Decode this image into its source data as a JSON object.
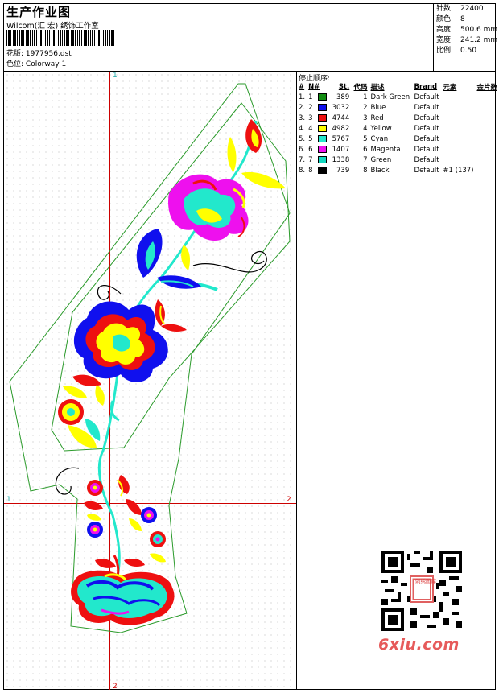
{
  "header": {
    "title": "生产作业图",
    "company": "Wilcom(汇 宏) 绣饰工作室",
    "design_label": "花版:",
    "design_value": "1977956.dst",
    "color_label": "色位:",
    "color_value": "Colorway 1"
  },
  "stats": [
    {
      "label": "针数:",
      "value": "22400"
    },
    {
      "label": "颜色:",
      "value": "8"
    },
    {
      "label": "高度:",
      "value": "500.6 mm"
    },
    {
      "label": "宽度:",
      "value": "241.2 mm"
    },
    {
      "label": "比例:",
      "value": "0.50"
    }
  ],
  "guides": {
    "top": "1",
    "left": "1",
    "right": "2",
    "bottom": "2"
  },
  "sequence": {
    "title": "停止顺序:",
    "headers": [
      "#",
      "N#",
      "St.",
      "代码",
      "描述",
      "Brand",
      "元素",
      "金片数"
    ],
    "rows": [
      {
        "idx": "1.",
        "n": "1",
        "color": "#118c11",
        "st": "389",
        "code": "1",
        "desc": "Dark Green",
        "brand": "Default",
        "elem": "",
        "seq": ""
      },
      {
        "idx": "2.",
        "n": "2",
        "color": "#1010ee",
        "st": "3032",
        "code": "2",
        "desc": "Blue",
        "brand": "Default",
        "elem": "",
        "seq": ""
      },
      {
        "idx": "3.",
        "n": "3",
        "color": "#ee1010",
        "st": "4744",
        "code": "3",
        "desc": "Red",
        "brand": "Default",
        "elem": "",
        "seq": ""
      },
      {
        "idx": "4.",
        "n": "4",
        "color": "#ffff00",
        "st": "4982",
        "code": "4",
        "desc": "Yellow",
        "brand": "Default",
        "elem": "",
        "seq": ""
      },
      {
        "idx": "5.",
        "n": "5",
        "color": "#22e8cc",
        "st": "5767",
        "code": "5",
        "desc": "Cyan",
        "brand": "Default",
        "elem": "",
        "seq": ""
      },
      {
        "idx": "6.",
        "n": "6",
        "color": "#ee10ee",
        "st": "1407",
        "code": "6",
        "desc": "Magenta",
        "brand": "Default",
        "elem": "",
        "seq": ""
      },
      {
        "idx": "7.",
        "n": "7",
        "color": "#10d8c0",
        "st": "1338",
        "code": "7",
        "desc": "Green",
        "brand": "Default",
        "elem": "",
        "seq": ""
      },
      {
        "idx": "8.",
        "n": "8",
        "color": "#000000",
        "st": "739",
        "code": "8",
        "desc": "Black",
        "brand": "Default",
        "elem": "#1 (137)",
        "seq": ""
      }
    ]
  },
  "watermark": {
    "text": "6xiu.com",
    "seal": "刺绣图库"
  },
  "colors": {
    "guide": "#cc0000",
    "outline": "#2a9a2a",
    "magenta": "#ee10ee",
    "blue": "#1010ee",
    "red": "#ee1010",
    "yellow": "#ffff00",
    "cyan": "#22e8cc"
  }
}
